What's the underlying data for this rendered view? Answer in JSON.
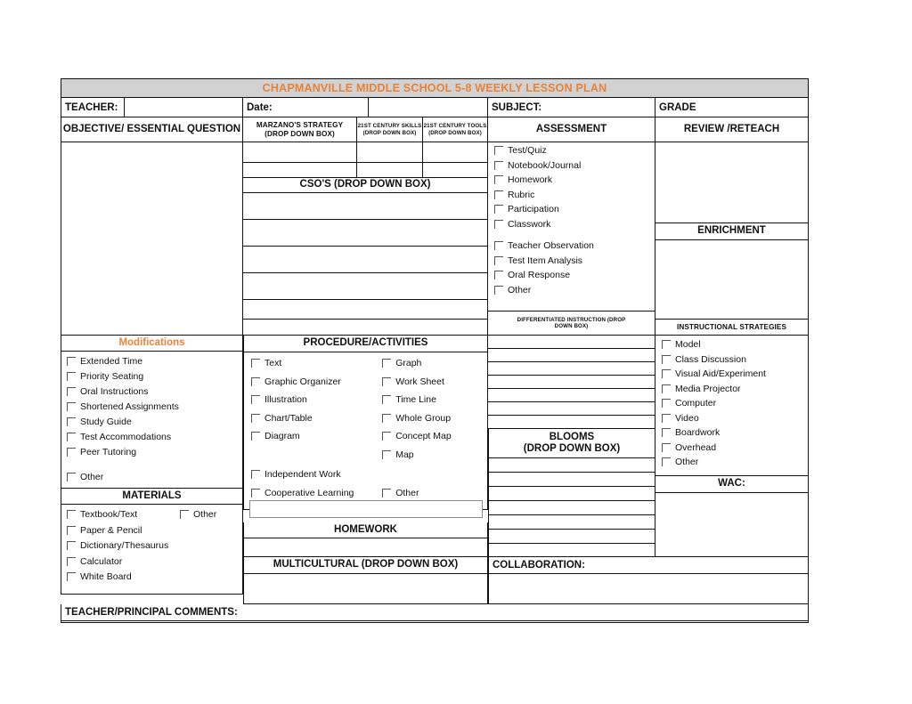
{
  "document": {
    "title": "CHAPMANVILLE MIDDLE SCHOOL 5-8 WEEKLY LESSON PLAN",
    "accent_color": "#e8833a",
    "header_band_color": "#d2d2d2"
  },
  "identity_row": {
    "teacher_label": "TEACHER:",
    "date_label": "Date:",
    "subject_label": "SUBJECT:",
    "grade_label": "GRADE",
    "teacher_value": "",
    "date_value": "",
    "subject_value": "",
    "grade_value": ""
  },
  "column_headers": {
    "objective": "OBJECTIVE/ ESSENTIAL QUESTION",
    "marzano": "MARZANO'S STRATEGY\n(DROP DOWN BOX)",
    "marzano_line1": "MARZANO'S STRATEGY",
    "marzano_line2": "(DROP DOWN BOX)",
    "skills_line1": "21ST CENTURY SKILLS",
    "skills_line2": "(DROP DOWN BOX)",
    "tools_line1": "21ST CENTURY TOOLS",
    "tools_line2": "(DROP DOWN BOX)",
    "assessment": "ASSESSMENT",
    "review_reteach": "REVIEW /RETEACH",
    "enrichment": "ENRICHMENT",
    "instructional_strategies": "INSTRUCTIONAL STRATEGIES",
    "wac": "WAC:",
    "cso": "CSO'S (DROP DOWN BOX)",
    "modifications": "Modifications",
    "materials": "MATERIALS",
    "procedure": "PROCEDURE/ACTIVITIES",
    "homework": "HOMEWORK",
    "multicultural": "MULTICULTURAL (DROP DOWN BOX)",
    "collaboration": "COLLABORATION:",
    "differentiated_line1": "DIFFERENTIATED INSTRUCTION (DROP",
    "differentiated_line2": "DOWN BOX)",
    "blooms_line1": "BLOOMS",
    "blooms_line2": "(DROP DOWN BOX)",
    "comments": "TEACHER/PRINCIPAL COMMENTS:"
  },
  "assessment_items": [
    "Test/Quiz",
    "Notebook/Journal",
    "Homework",
    "Rubric",
    "Participation",
    "Classwork",
    "Teacher Observation",
    "Test Item Analysis",
    "Oral Response",
    "Other"
  ],
  "modifications_items": [
    "Extended Time",
    "Priority Seating",
    "Oral Instructions",
    "Shortened Assignments",
    "Study Guide",
    "Test Accommodations",
    "Peer Tutoring",
    "Other"
  ],
  "materials_items_left": [
    "Textbook/Text",
    "Paper & Pencil",
    "Dictionary/Thesaurus",
    "Calculator",
    "White Board"
  ],
  "materials_items_right": [
    "Other"
  ],
  "procedure_items_left": [
    "Text",
    "Graphic Organizer",
    "Illustration",
    "Chart/Table",
    "Diagram"
  ],
  "procedure_items_right": [
    "Graph",
    "Work Sheet",
    "Time Line",
    "Whole Group",
    "Concept Map",
    "Map"
  ],
  "procedure_items_lower_left": [
    "Independent Work",
    "Cooperative Learning"
  ],
  "procedure_items_lower_right": [
    "Other"
  ],
  "procedure_other_value": "",
  "instructional_items": [
    "Model",
    "Class Discussion",
    "Visual Aid/Experiment",
    "Media Projector",
    "Computer",
    "Video",
    "Boardwork",
    "Overhead",
    "Other"
  ],
  "fill_values": {
    "objective": "",
    "marzano": "",
    "skills": "",
    "tools": "",
    "cso_rows": [
      "",
      "",
      "",
      "",
      "",
      ""
    ],
    "review_reteach": "",
    "enrichment": "",
    "differentiated_rows": [
      "",
      "",
      "",
      "",
      "",
      "",
      ""
    ],
    "blooms_rows": [
      "",
      "",
      "",
      "",
      "",
      ""
    ],
    "wac": "",
    "homework": "",
    "multicultural": "",
    "collaboration": "",
    "comments": ""
  }
}
